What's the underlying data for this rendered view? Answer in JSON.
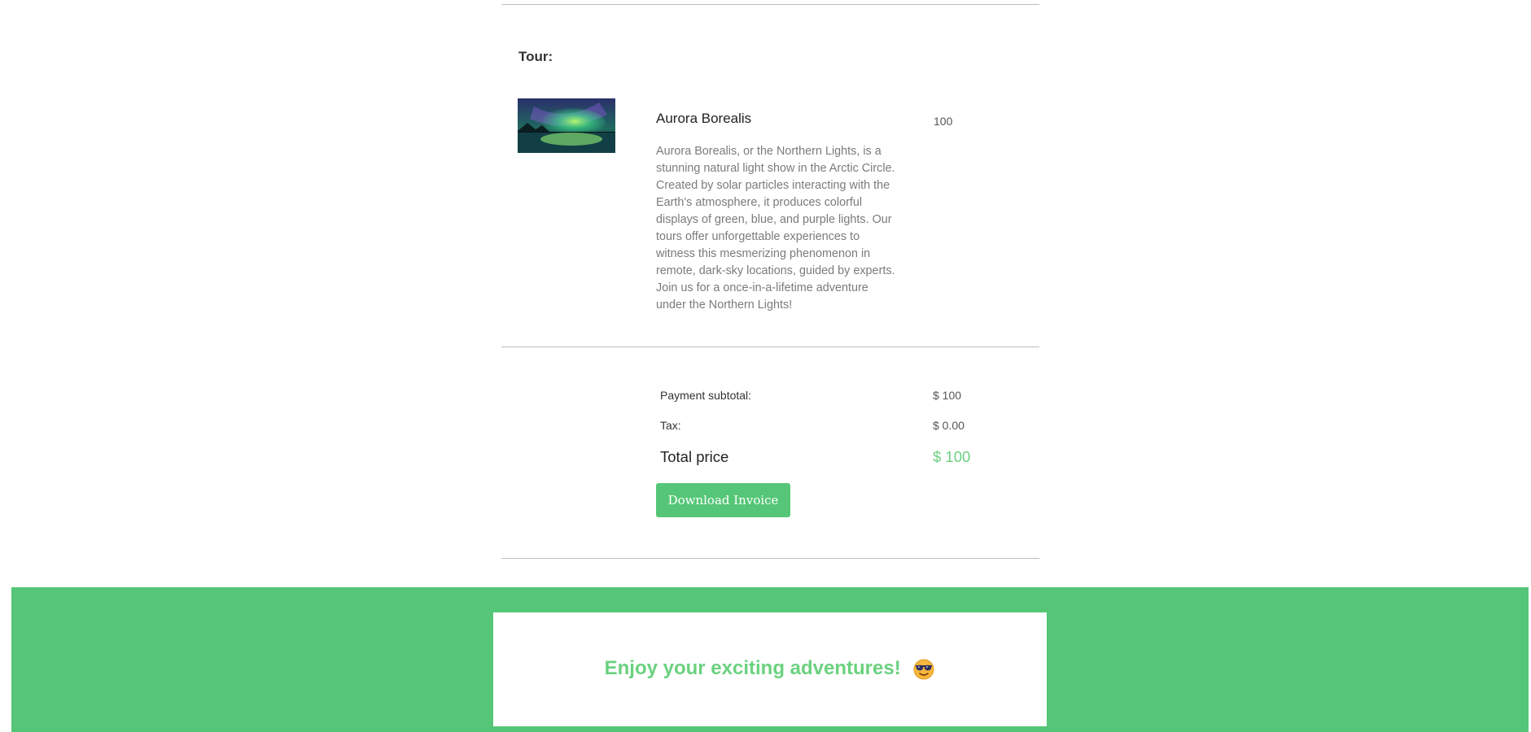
{
  "tour": {
    "heading": "Tour:",
    "name": "Aurora Borealis",
    "description": "Aurora Borealis, or the Northern Lights, is a stunning natural light show in the Arctic Circle. Created by solar particles interacting with the Earth's atmosphere, it produces colorful displays of green, blue, and purple lights. Our tours offer unforgettable experiences to witness this mesmerizing phenomenon in remote, dark-sky locations, guided by experts. Join us for a once-in-a-lifetime adventure under the Northern Lights!",
    "quantity": "100",
    "image_icon": "aurora-photo"
  },
  "summary": {
    "subtotal_label": "Payment subtotal:",
    "subtotal_value": "$ 100",
    "tax_label": "Tax:",
    "tax_value": "$ 0.00",
    "total_label": "Total price",
    "total_value": "$ 100"
  },
  "actions": {
    "download_label": "Download Invoice"
  },
  "footer": {
    "message": "Enjoy your exciting adventures!",
    "emoji_icon": "sunglasses-face-icon"
  },
  "colors": {
    "accent_green": "#55c677",
    "total_green": "#6bd17f",
    "divider": "#bdbdbd"
  }
}
